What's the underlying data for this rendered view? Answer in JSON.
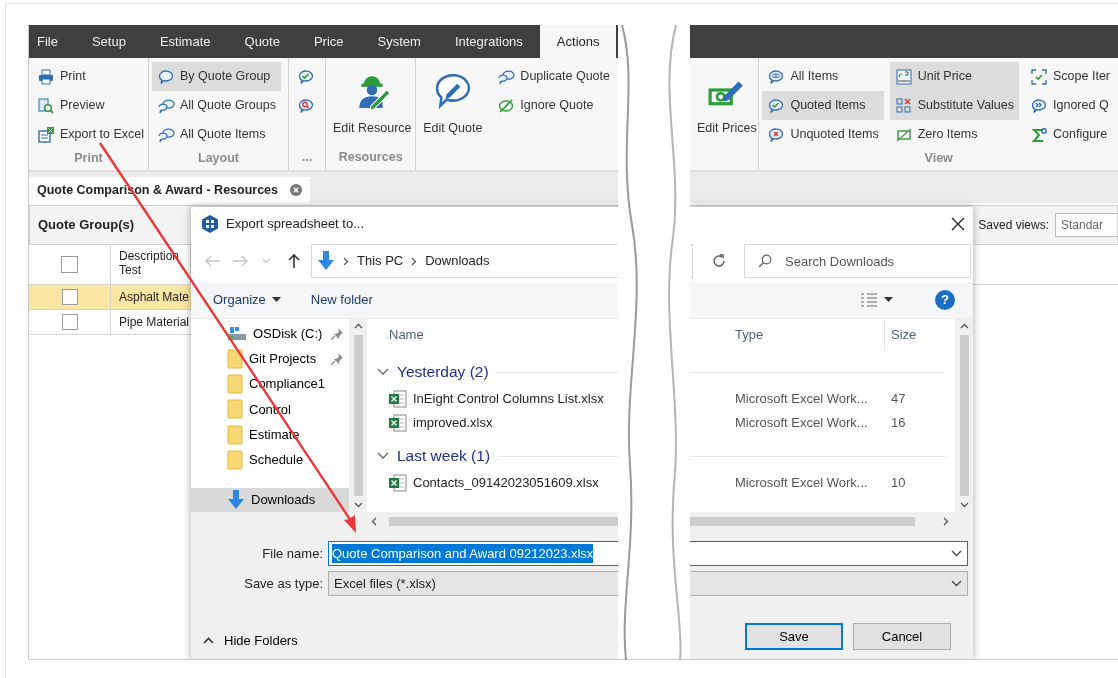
{
  "menu_tabs": [
    {
      "label": "File",
      "selected": false
    },
    {
      "label": "Setup",
      "selected": false
    },
    {
      "label": "Estimate",
      "selected": false
    },
    {
      "label": "Quote",
      "selected": false
    },
    {
      "label": "Price",
      "selected": false
    },
    {
      "label": "System",
      "selected": false
    },
    {
      "label": "Integrations",
      "selected": false
    },
    {
      "label": "Actions",
      "selected": true
    }
  ],
  "ribbon_left": {
    "groups": [
      {
        "label": "Print",
        "columns": [
          [
            {
              "kind": "small",
              "label": "Print",
              "selected": false
            },
            {
              "kind": "small",
              "label": "Preview",
              "selected": false
            },
            {
              "kind": "small",
              "label": "Export to Excel",
              "selected": false
            }
          ]
        ]
      },
      {
        "label": "Layout",
        "columns": [
          [
            {
              "kind": "small",
              "label": "By Quote Group",
              "selected": true
            },
            {
              "kind": "small",
              "label": "All Quote Groups",
              "selected": false
            },
            {
              "kind": "small",
              "label": "All Quote Items",
              "selected": false
            }
          ]
        ]
      },
      {
        "label": "...",
        "columns": [
          [
            {
              "kind": "icon",
              "selected": false
            },
            {
              "kind": "icon",
              "selected": false
            }
          ]
        ]
      },
      {
        "label": "Resources",
        "columns": [
          [
            {
              "kind": "large",
              "label": "Edit Resource",
              "selected": false
            }
          ]
        ]
      },
      {
        "columns": [
          [
            {
              "kind": "large",
              "label": "Edit Quote",
              "selected": false
            }
          ],
          [
            {
              "kind": "small",
              "label": "Duplicate Quote",
              "selected": false
            },
            {
              "kind": "small",
              "label": "Ignore Quote",
              "selected": false
            }
          ]
        ]
      }
    ]
  },
  "ribbon_right": {
    "groups": [
      {
        "columns": [
          [
            {
              "kind": "large",
              "label": "Edit Prices",
              "selected": false
            }
          ]
        ]
      },
      {
        "label": "View",
        "columns": [
          [
            {
              "kind": "small",
              "label": "All Items",
              "selected": false
            },
            {
              "kind": "small",
              "label": "Quoted Items",
              "selected": true
            },
            {
              "kind": "small",
              "label": "Unquoted Items",
              "selected": false
            }
          ],
          [
            {
              "kind": "small",
              "label": "Unit Price",
              "selected": true
            },
            {
              "kind": "small",
              "label": "Substitute Values",
              "selected": true
            },
            {
              "kind": "small",
              "label": "Zero Items",
              "selected": false
            }
          ],
          [
            {
              "kind": "small",
              "label": "Scope Iter",
              "selected": false
            },
            {
              "kind": "small",
              "label": "Ignored Q",
              "selected": false
            },
            {
              "kind": "small",
              "label": "Configure",
              "selected": false
            }
          ]
        ]
      }
    ]
  },
  "document_tab": {
    "title": "Quote Comparison & Award - Resources"
  },
  "panel": {
    "title": "Quote Group(s)",
    "saved_views_label": "Saved views:",
    "saved_view": "Standar"
  },
  "grid": {
    "header_checked": false,
    "column_header": "Description Test",
    "rows": [
      {
        "description": "Asphalt Mate",
        "checked": false,
        "selected": true
      },
      {
        "description": "Pipe Material",
        "checked": false,
        "selected": false
      }
    ]
  },
  "dialog": {
    "title": "Export spreadsheet to...",
    "nav_buttons": [
      {
        "kind": "back",
        "disabled": true
      },
      {
        "kind": "forward",
        "disabled": true
      },
      {
        "kind": "recent",
        "disabled": true
      },
      {
        "kind": "up",
        "disabled": false
      }
    ],
    "breadcrumb": [
      "This PC",
      "Downloads"
    ],
    "search_placeholder": "Search Downloads",
    "toolbar": [
      {
        "label": "Organize",
        "kind": "menu"
      },
      {
        "label": "New folder",
        "kind": "plain"
      }
    ],
    "help_button": "?",
    "nav_items": [
      {
        "label": "OSDisk (C:)",
        "kind": "drive",
        "pinned": true,
        "selected": false
      },
      {
        "label": "Git Projects",
        "kind": "folder",
        "pinned": true,
        "selected": false
      },
      {
        "label": "Compliance1",
        "kind": "folder",
        "pinned": false,
        "selected": false
      },
      {
        "label": "Control",
        "kind": "folder",
        "pinned": false,
        "selected": false
      },
      {
        "label": "Estimate",
        "kind": "folder",
        "pinned": false,
        "selected": false
      },
      {
        "label": "Schedule",
        "kind": "folder",
        "pinned": false,
        "selected": false
      },
      {
        "label": "Downloads",
        "kind": "downloads",
        "pinned": false,
        "selected": true
      }
    ],
    "columns": [
      "Name",
      "Type",
      "Size"
    ],
    "file_groups": [
      {
        "label": "Yesterday (2)",
        "expanded": true,
        "files": [
          {
            "name": "InEight Control Columns List.xlsx",
            "type": "Microsoft Excel Work...",
            "size": "47"
          },
          {
            "name": "improved.xlsx",
            "type": "Microsoft Excel Work...",
            "size": "16"
          }
        ]
      },
      {
        "label": "Last week (1)",
        "expanded": true,
        "files": [
          {
            "name": "Contacts_09142023051609.xlsx",
            "type": "Microsoft Excel Work...",
            "size": "10"
          }
        ]
      }
    ],
    "file_name_label": "File name:",
    "file_name": "Quote Comparison and Award 09212023.xlsx",
    "file_name_selected": true,
    "save_as_type_label": "Save as type:",
    "save_as_type": "Excel files (*.xlsx)",
    "hide_folders": "Hide Folders",
    "buttons": [
      {
        "label": "Save",
        "default": true
      },
      {
        "label": "Cancel",
        "default": false
      }
    ]
  }
}
